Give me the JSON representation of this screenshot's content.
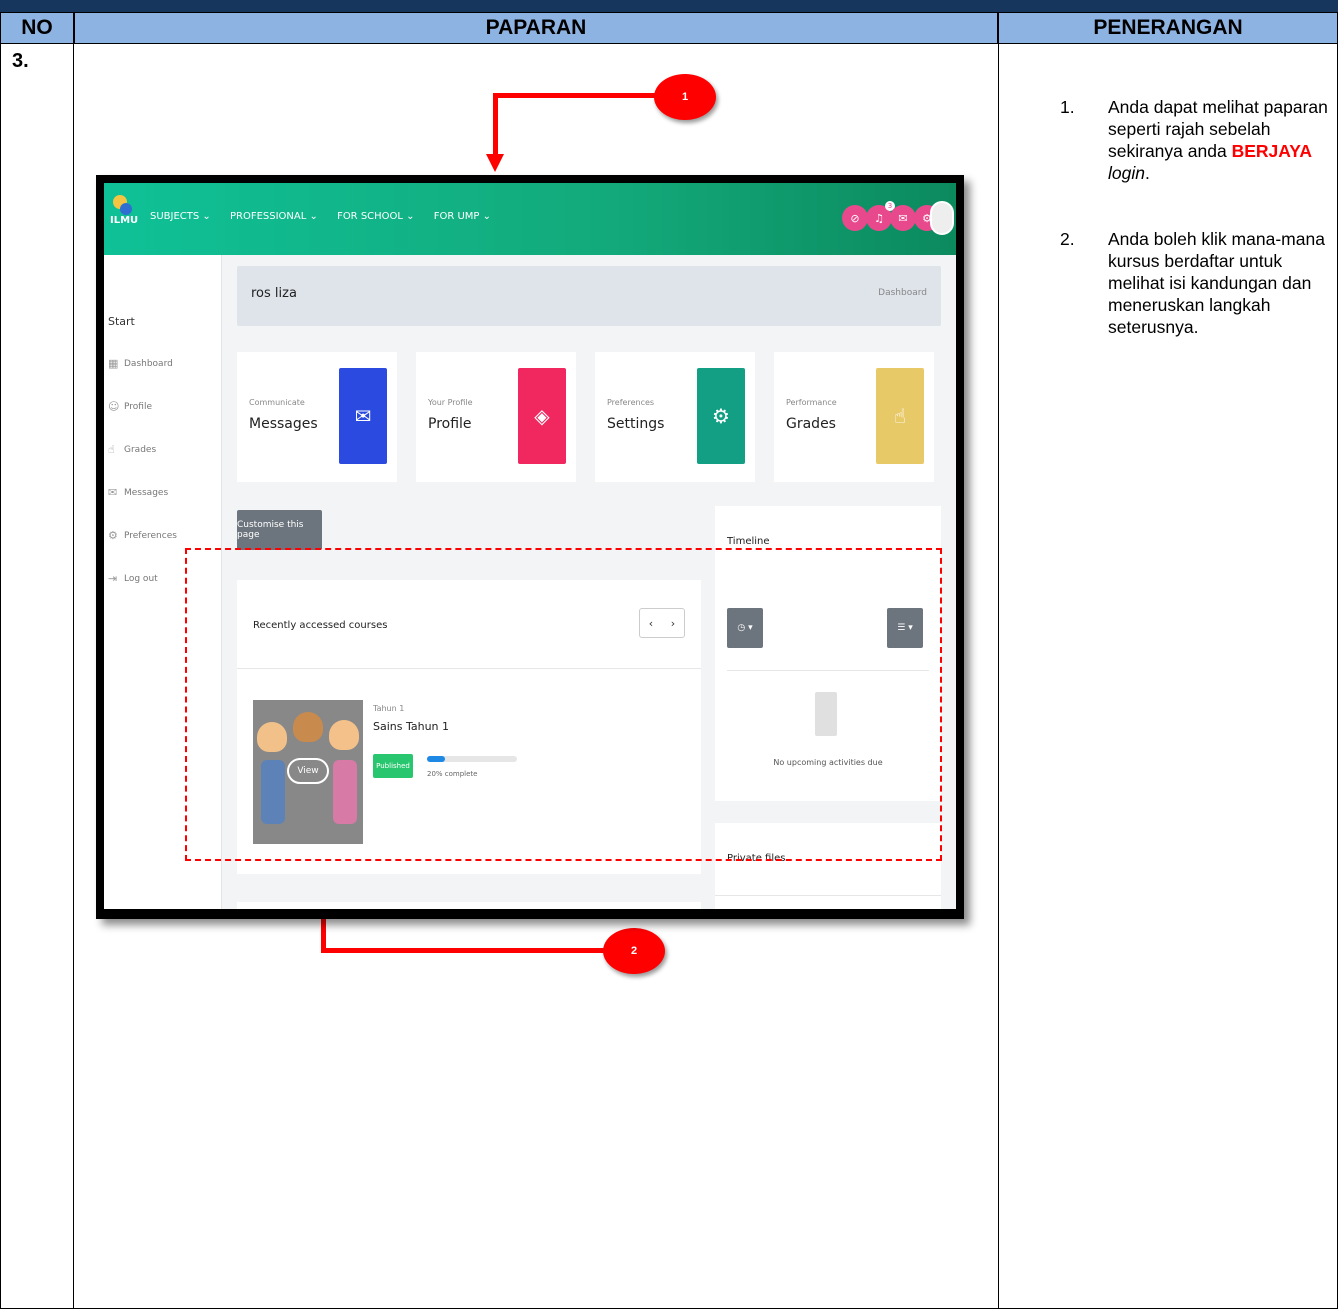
{
  "table": {
    "headers": [
      "NO",
      "PAPARAN",
      "PENERANGAN"
    ],
    "row_number": "3."
  },
  "description": {
    "items": [
      {
        "num": "1.",
        "text_before": "Anda dapat melihat paparan seperti rajah sebelah sekiranya anda ",
        "highlight": "BERJAYA",
        "text_italic": "login",
        "text_after": "."
      },
      {
        "num": "2.",
        "text": "Anda boleh klik mana-mana kursus berdaftar untuk melihat isi kandungan dan meneruskan langkah seterusnya."
      }
    ]
  },
  "callouts": [
    "1",
    "2"
  ],
  "screenshot": {
    "logo": "ILMU",
    "menu": [
      "SUBJECTS ⌄",
      "PROFESSIONAL ⌄",
      "FOR SCHOOL ⌄",
      "FOR UMP ⌄"
    ],
    "notification_count": "3",
    "sidebar": {
      "start": "Start",
      "items": [
        "Dashboard",
        "Profile",
        "Grades",
        "Messages",
        "Preferences",
        "Log out"
      ]
    },
    "user_name": "ros liza",
    "breadcrumb": "Dashboard",
    "cards": [
      {
        "small": "Communicate",
        "label": "Messages",
        "color": "#2b4be0",
        "icon": "chat-icon"
      },
      {
        "small": "Your Profile",
        "label": "Profile",
        "color": "#f0285f",
        "icon": "graduation-cap-icon"
      },
      {
        "small": "Preferences",
        "label": "Settings",
        "color": "#139f84",
        "icon": "gear-icon"
      },
      {
        "small": "Performance",
        "label": "Grades",
        "color": "#e8c968",
        "icon": "grades-icon"
      }
    ],
    "customise_button": "Customise this page",
    "recent": {
      "title": "Recently accessed courses",
      "course": {
        "category": "Tahun 1",
        "name": "Sains Tahun 1",
        "view_label": "View",
        "status": "Published",
        "progress_percent": 20,
        "progress_text": "20% complete"
      }
    },
    "timeline": {
      "title": "Timeline",
      "empty_text": "No upcoming activities due"
    },
    "private_files": "Private files"
  }
}
